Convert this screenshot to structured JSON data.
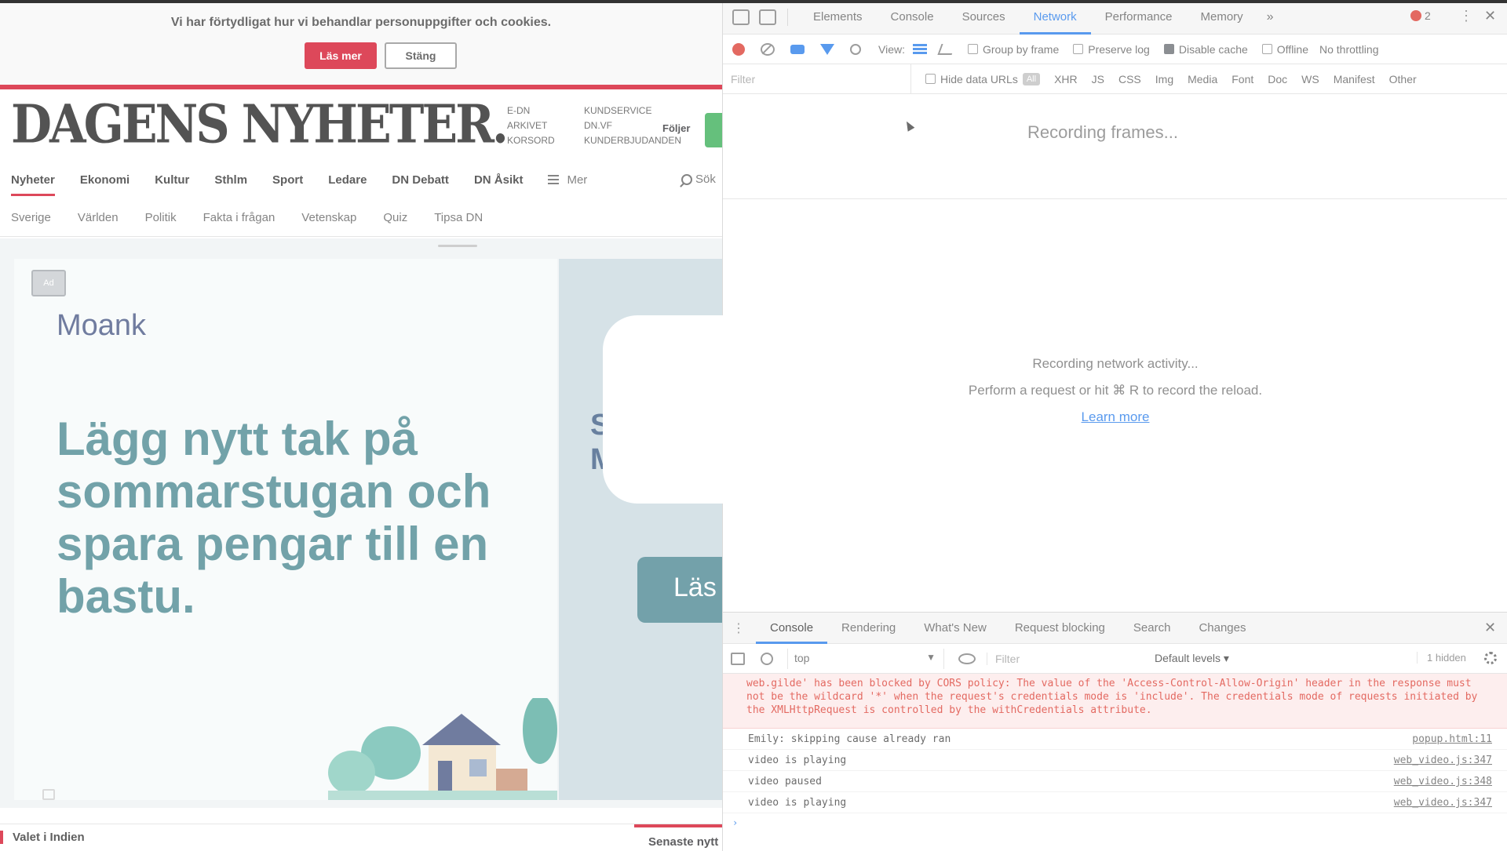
{
  "page": {
    "cookie_text": "Vi har förtydligat hur vi behandlar personuppgifter och cookies.",
    "cookie_more": "Läs mer",
    "cookie_close": "Stäng",
    "logo": "DAGENS NYHETER.",
    "masthead_col1": [
      "E-DN",
      "ARKIVET",
      "KORSORD"
    ],
    "masthead_col2": [
      "KUNDSERVICE",
      "DN.VF",
      "KUNDERBJUDANDEN"
    ],
    "masthead_follow": "Följer",
    "nav_main": [
      "Nyheter",
      "Ekonomi",
      "Kultur",
      "Sthlm",
      "Sport",
      "Ledare",
      "DN Debatt",
      "DN Åsikt"
    ],
    "nav_menu": "Mer",
    "nav_search": "Sök",
    "nav_sub": [
      "Sverige",
      "Världen",
      "Politik",
      "Fakta i frågan",
      "Vetenskap",
      "Quiz",
      "Tipsa DN"
    ],
    "ad": {
      "badge": "Ad",
      "brand": "Moank",
      "headline": "Lägg nytt tak på sommarstugan och spara pengar till en bastu.",
      "right_text_1": "S",
      "right_text_2": "M",
      "right_button": "Läs"
    },
    "bottom_left": "Valet i Indien",
    "bottom_right": "Senaste nytt"
  },
  "devtools": {
    "tabs": [
      "Elements",
      "Console",
      "Sources",
      "Network",
      "Performance",
      "Memory"
    ],
    "active_tab": "Network",
    "more": "»",
    "error_count": "2",
    "toolbar": {
      "view_label": "View:",
      "group_by_frame": "Group by frame",
      "preserve_log": "Preserve log",
      "disable_cache": "Disable cache",
      "offline": "Offline",
      "throttling": "No throttling"
    },
    "filter_placeholder": "Filter",
    "hide_data_urls": "Hide data URLs",
    "all_label": "All",
    "types": [
      "XHR",
      "JS",
      "CSS",
      "Img",
      "Media",
      "Font",
      "Doc",
      "WS",
      "Manifest",
      "Other"
    ],
    "frames_text": "Recording frames...",
    "empty_line1": "Recording network activity...",
    "empty_line2": "Perform a request or hit ⌘ R to record the reload.",
    "learn_more": "Learn more",
    "drawer_tabs": [
      "Console",
      "Rendering",
      "What's New",
      "Request blocking",
      "Search",
      "Changes"
    ],
    "console_context": "top",
    "console_filter": "Filter",
    "console_levels": "Default levels ▾",
    "console_hidden": "1 hidden",
    "error_message": "web.gilde' has been blocked by CORS policy: The value of the 'Access-Control-Allow-Origin' header in the response must not be the wildcard '*' when the request's credentials mode is 'include'. The credentials mode of requests initiated by the XMLHttpRequest is controlled by the withCredentials attribute.",
    "messages": [
      {
        "text": "Emily: skipping cause already ran",
        "source": "popup.html:11"
      },
      {
        "text": "video is playing",
        "source": "web_video.js:347"
      },
      {
        "text": "video paused",
        "source": "web_video.js:348"
      },
      {
        "text": "video is playing",
        "source": "web_video.js:347"
      }
    ],
    "prompt": "›"
  },
  "colors": {
    "brand_red": "#d0021b",
    "devtools_blue": "#1a73e8",
    "ad_teal": "#3c7f88"
  },
  "overlay_icon": "video-camera-icon"
}
